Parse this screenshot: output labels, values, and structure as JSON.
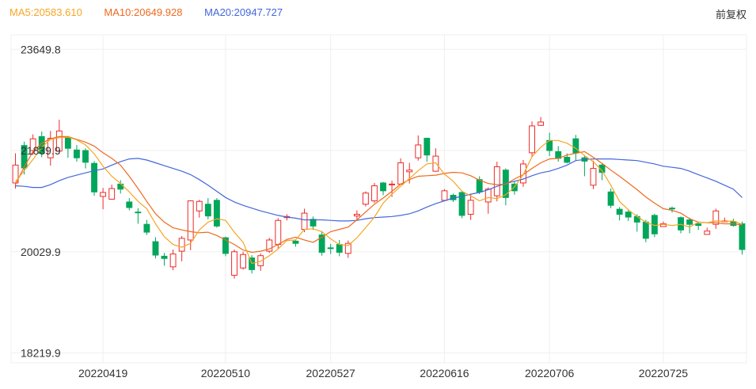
{
  "legend": {
    "ma5": {
      "label": "MA5:20583.610",
      "color": "#f5a623"
    },
    "ma10": {
      "label": "MA10:20649.928",
      "color": "#ee6a1e"
    },
    "ma20": {
      "label": "MA20:20947.727",
      "color": "#4466dd"
    }
  },
  "adjust_label": "前复权",
  "colors": {
    "up": "#ee2a2a",
    "down": "#00a65a",
    "grid": "#efefef",
    "axis": "#dddddd"
  },
  "chart_data": {
    "type": "candlestick",
    "y_ticks": [
      {
        "value": 23649.8,
        "label": "23649.8"
      },
      {
        "value": 21839.9,
        "label": "21839.9"
      },
      {
        "value": 20029.9,
        "label": "20029.9"
      },
      {
        "value": 18219.9,
        "label": "18219.9"
      }
    ],
    "ylim": [
      18043.1,
      23908.6
    ],
    "x_labels": [
      {
        "index": 10,
        "label": "20220419"
      },
      {
        "index": 24,
        "label": "20220510"
      },
      {
        "index": 36,
        "label": "20220527"
      },
      {
        "index": 49,
        "label": "20220616"
      },
      {
        "index": 61,
        "label": "20220706"
      },
      {
        "index": 74,
        "label": "20220725"
      }
    ],
    "candles": [
      [
        21260,
        21580,
        21790,
        21160
      ],
      [
        21930,
        21530,
        22000,
        21410
      ],
      [
        21840,
        22050,
        22130,
        21760
      ],
      [
        22090,
        21790,
        22180,
        21720
      ],
      [
        21710,
        22060,
        22190,
        21570
      ],
      [
        21830,
        22190,
        22390,
        21780
      ],
      [
        22070,
        21880,
        22100,
        21710
      ],
      [
        21850,
        21710,
        21940,
        21640
      ],
      [
        21840,
        21630,
        21880,
        21520
      ],
      [
        21610,
        21100,
        21650,
        21030
      ],
      [
        21020,
        21090,
        21170,
        20790
      ],
      [
        20970,
        21160,
        21230,
        20960
      ],
      [
        21240,
        21150,
        21310,
        21070
      ],
      [
        20920,
        20820,
        20990,
        20770
      ],
      [
        20740,
        20730,
        20810,
        20530
      ],
      [
        20520,
        20380,
        20600,
        20330
      ],
      [
        20210,
        19970,
        20290,
        19910
      ],
      [
        19950,
        19910,
        20010,
        19780
      ],
      [
        19760,
        19990,
        20070,
        19700
      ],
      [
        20040,
        20270,
        20310,
        19860
      ],
      [
        20240,
        20940,
        20950,
        20060
      ],
      [
        20760,
        20930,
        20960,
        20640
      ],
      [
        20880,
        20670,
        20990,
        20610
      ],
      [
        20950,
        20490,
        20990,
        20460
      ],
      [
        20280,
        20000,
        20300,
        19950
      ],
      [
        19610,
        20030,
        20070,
        19550
      ],
      [
        19740,
        19980,
        20030,
        19710
      ],
      [
        19920,
        19710,
        19970,
        19640
      ],
      [
        19780,
        19960,
        20000,
        19690
      ],
      [
        20040,
        20240,
        20280,
        20010
      ],
      [
        20160,
        20590,
        20630,
        20090
      ],
      [
        20640,
        20660,
        20700,
        20590
      ],
      [
        20220,
        20180,
        20250,
        20120
      ],
      [
        20430,
        20720,
        20800,
        20380
      ],
      [
        20610,
        20490,
        20660,
        20420
      ],
      [
        20330,
        20020,
        20400,
        19960
      ],
      [
        20100,
        20090,
        20170,
        19990
      ],
      [
        20160,
        20020,
        20240,
        19950
      ],
      [
        20000,
        20180,
        20230,
        19920
      ],
      [
        20670,
        20700,
        20770,
        20600
      ],
      [
        20880,
        21080,
        21110,
        20840
      ],
      [
        20940,
        21210,
        21260,
        20900
      ],
      [
        21260,
        21120,
        21280,
        21040
      ],
      [
        21230,
        21240,
        21300,
        21010
      ],
      [
        21240,
        21620,
        21700,
        21230
      ],
      [
        21460,
        21490,
        21620,
        21250
      ],
      [
        21710,
        21940,
        22110,
        21660
      ],
      [
        22060,
        21760,
        22070,
        21640
      ],
      [
        21470,
        21740,
        21880,
        21460
      ],
      [
        20950,
        21120,
        21150,
        20970
      ],
      [
        21040,
        20960,
        21070,
        20920
      ],
      [
        21090,
        20680,
        21120,
        20630
      ],
      [
        20700,
        20950,
        21060,
        20600
      ],
      [
        21320,
        21100,
        21380,
        21060
      ],
      [
        20920,
        21150,
        21180,
        20710
      ],
      [
        21030,
        21550,
        21640,
        20930
      ],
      [
        21490,
        21000,
        21520,
        20860
      ],
      [
        21240,
        21120,
        21290,
        21050
      ],
      [
        21260,
        21600,
        21670,
        21190
      ],
      [
        21800,
        22280,
        22360,
        21720
      ],
      [
        22290,
        22350,
        22440,
        22280
      ],
      [
        22020,
        21840,
        22160,
        21740
      ],
      [
        21820,
        21700,
        21920,
        21640
      ],
      [
        21720,
        21630,
        21790,
        21610
      ],
      [
        22050,
        21800,
        22120,
        21660
      ],
      [
        21710,
        21650,
        21760,
        21380
      ],
      [
        21220,
        21520,
        21660,
        21150
      ],
      [
        21580,
        21450,
        21610,
        21310
      ],
      [
        21100,
        20860,
        21160,
        20810
      ],
      [
        20790,
        20700,
        20830,
        20590
      ],
      [
        20740,
        20650,
        20790,
        20580
      ],
      [
        20660,
        20560,
        20700,
        20390
      ],
      [
        20560,
        20270,
        20600,
        20200
      ],
      [
        20680,
        20350,
        20710,
        20290
      ],
      [
        20480,
        20530,
        20570,
        20480
      ],
      [
        20810,
        20800,
        20840,
        20730
      ],
      [
        20640,
        20420,
        20660,
        20360
      ],
      [
        20600,
        20520,
        20640,
        20360
      ],
      [
        20530,
        20500,
        20560,
        20420
      ],
      [
        20340,
        20400,
        20460,
        20410
      ],
      [
        20520,
        20760,
        20800,
        20440
      ],
      [
        20580,
        20580,
        20640,
        20560
      ],
      [
        20570,
        20500,
        20620,
        20480
      ],
      [
        20530,
        20070,
        20570,
        19980
      ]
    ],
    "ma5": [
      21280,
      21480,
      21680,
      21900,
      22040,
      22070,
      22080,
      22030,
      21940,
      21780,
      21560,
      21380,
      21250,
      21100,
      20930,
      20800,
      20530,
      20300,
      20160,
      20110,
      20180,
      20420,
      20560,
      20620,
      20590,
      20380,
      20200,
      19820,
      19860,
      19960,
      20080,
      20230,
      20240,
      20430,
      20440,
      20390,
      20260,
      20160,
      20140,
      20280,
      20460,
      20650,
      20900,
      21060,
      21200,
      21340,
      21480,
      21600,
      21620,
      21420,
      21290,
      21110,
      21030,
      20940,
      21000,
      20980,
      21050,
      21190,
      21410,
      21730,
      21900,
      22020,
      22020,
      21970,
      21880,
      21750,
      21640,
      21480,
      21220,
      20930,
      20780,
      20660,
      20560,
      20500,
      20520,
      20500,
      20520,
      20470,
      20560,
      20550,
      20580,
      20570,
      20580,
      20520
    ],
    "ma10": [
      21230,
      21550,
      21820,
      21970,
      22050,
      22090,
      22090,
      22040,
      21990,
      21920,
      21800,
      21700,
      21580,
      21380,
      21160,
      20930,
      20710,
      20560,
      20460,
      20420,
      20390,
      20370,
      20380,
      20320,
      20240,
      20160,
      20060,
      20020,
      20040,
      20080,
      20160,
      20250,
      20290,
      20240,
      20200,
      20290,
      20390,
      20430,
      20470,
      20600,
      20740,
      20880,
      20990,
      21110,
      21240,
      21320,
      21380,
      21390,
      21400,
      21430,
      21450,
      21440,
      21390,
      21310,
      21250,
      21230,
      21240,
      21330,
      21410,
      21520,
      21620,
      21690,
      21700,
      21760,
      21790,
      21820,
      21720,
      21610,
      21490,
      21380,
      21260,
      21140,
      21010,
      20900,
      20800,
      20770,
      20720,
      20620,
      20560,
      20550,
      20550,
      20530,
      20530,
      20510
    ],
    "ma20": [
      21210,
      21200,
      21180,
      21180,
      21230,
      21300,
      21360,
      21400,
      21440,
      21480,
      21510,
      21580,
      21640,
      21690,
      21700,
      21670,
      21620,
      21570,
      21520,
      21470,
      21410,
      21320,
      21220,
      21110,
      21000,
      20920,
      20860,
      20810,
      20760,
      20720,
      20680,
      20650,
      20630,
      20600,
      20600,
      20600,
      20590,
      20580,
      20580,
      20590,
      20620,
      20640,
      20650,
      20660,
      20680,
      20710,
      20760,
      20830,
      20890,
      20940,
      20990,
      21020,
      21060,
      21090,
      21140,
      21200,
      21250,
      21290,
      21330,
      21390,
      21440,
      21470,
      21520,
      21580,
      21660,
      21680,
      21690,
      21690,
      21690,
      21680,
      21670,
      21660,
      21630,
      21600,
      21560,
      21540,
      21520,
      21470,
      21410,
      21350,
      21290,
      21220,
      21150,
      21000
    ]
  }
}
